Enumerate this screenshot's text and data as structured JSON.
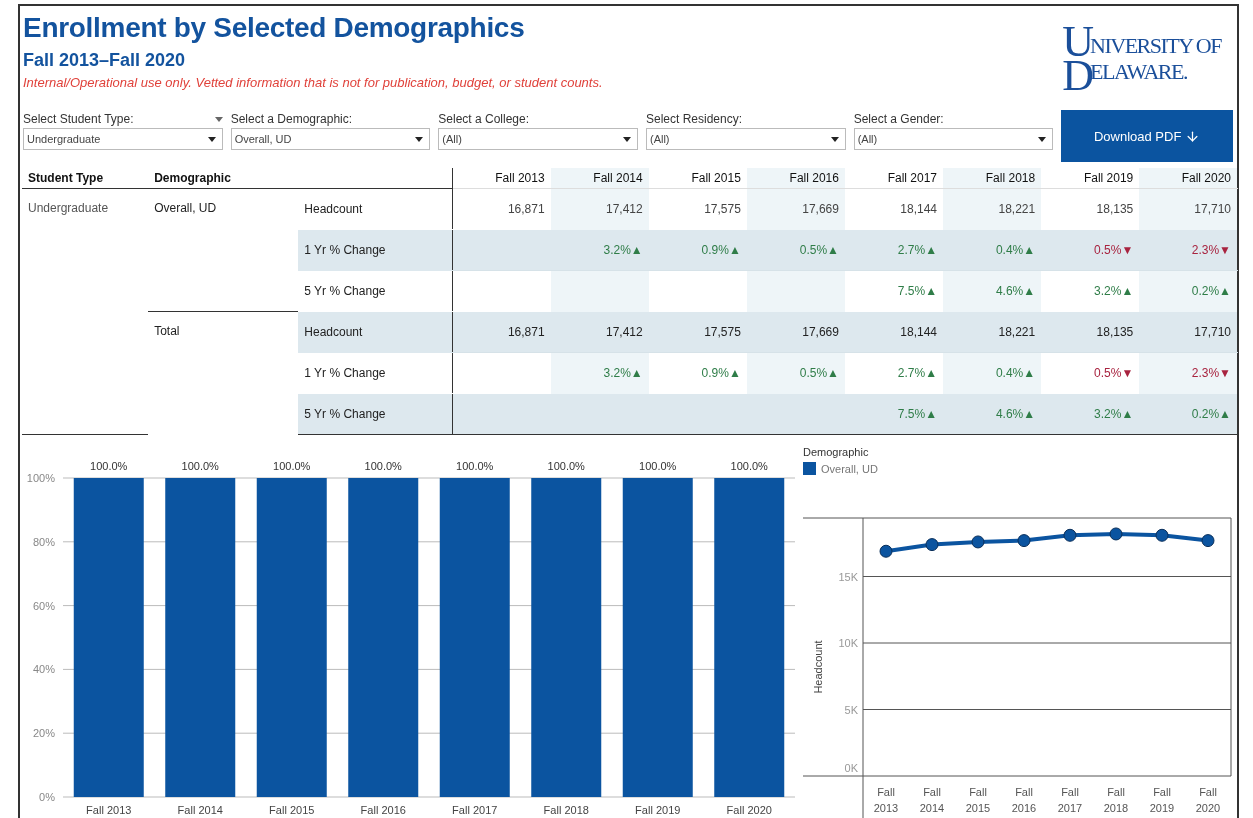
{
  "header": {
    "title": "Enrollment by Selected Demographics",
    "subtitle": "Fall 2013–Fall 2020",
    "note": "Internal/Operational use only. Vetted information that is not for publication, budget, or student counts."
  },
  "logo": {
    "initials": [
      "U",
      "D"
    ],
    "lines": [
      "NIVERSITY OF",
      "ELAWARE."
    ]
  },
  "filters": [
    {
      "label": "Select Student Type:",
      "value": "Undergraduate",
      "menu_icon": true
    },
    {
      "label": "Select a Demographic:",
      "value": "Overall, UD"
    },
    {
      "label": "Select a College:",
      "value": "(All)"
    },
    {
      "label": "Select Residency:",
      "value": "(All)"
    },
    {
      "label": "Select a Gender:",
      "value": "(All)"
    }
  ],
  "download_button": {
    "label": "Download PDF"
  },
  "table": {
    "columns": [
      "Student Type",
      "Demographic"
    ],
    "years": [
      "Fall 2013",
      "Fall 2014",
      "Fall 2015",
      "Fall 2016",
      "Fall 2017",
      "Fall 2018",
      "Fall 2019",
      "Fall 2020"
    ],
    "groups": [
      {
        "student_type": "Undergraduate",
        "demographics": [
          {
            "name": "Overall, UD",
            "measures": [
              {
                "label": "Headcount",
                "cells": [
                  {
                    "text": "16,871"
                  },
                  {
                    "text": "17,412"
                  },
                  {
                    "text": "17,575"
                  },
                  {
                    "text": "17,669"
                  },
                  {
                    "text": "18,144"
                  },
                  {
                    "text": "18,221"
                  },
                  {
                    "text": "18,135"
                  },
                  {
                    "text": "17,710"
                  }
                ]
              },
              {
                "label": "1 Yr % Change",
                "cells": [
                  null,
                  {
                    "text": "3.2%▲",
                    "color": "#2f7d48"
                  },
                  {
                    "text": "0.9%▲",
                    "color": "#2f7d48"
                  },
                  {
                    "text": "0.5%▲",
                    "color": "#2f7d48"
                  },
                  {
                    "text": "2.7%▲",
                    "color": "#2f7d48"
                  },
                  {
                    "text": "0.4%▲",
                    "color": "#2f7d48"
                  },
                  {
                    "text": "0.5%▼",
                    "color": "#a8233f"
                  },
                  {
                    "text": "2.3%▼",
                    "color": "#a8233f"
                  }
                ]
              },
              {
                "label": "5 Yr % Change",
                "cells": [
                  null,
                  null,
                  null,
                  null,
                  {
                    "text": "7.5%▲",
                    "color": "#2f7d48"
                  },
                  {
                    "text": "4.6%▲",
                    "color": "#2f7d48"
                  },
                  {
                    "text": "3.2%▲",
                    "color": "#2f7d48"
                  },
                  {
                    "text": "0.2%▲",
                    "color": "#2f7d48"
                  }
                ]
              }
            ]
          },
          {
            "name": "Total",
            "measures": [
              {
                "label": "Headcount",
                "cells": [
                  {
                    "text": "16,871"
                  },
                  {
                    "text": "17,412"
                  },
                  {
                    "text": "17,575"
                  },
                  {
                    "text": "17,669"
                  },
                  {
                    "text": "18,144"
                  },
                  {
                    "text": "18,221"
                  },
                  {
                    "text": "18,135"
                  },
                  {
                    "text": "17,710"
                  }
                ]
              },
              {
                "label": "1 Yr % Change",
                "cells": [
                  null,
                  {
                    "text": "3.2%▲",
                    "color": "#2f7d48"
                  },
                  {
                    "text": "0.9%▲",
                    "color": "#2f7d48"
                  },
                  {
                    "text": "0.5%▲",
                    "color": "#2f7d48"
                  },
                  {
                    "text": "2.7%▲",
                    "color": "#2f7d48"
                  },
                  {
                    "text": "0.4%▲",
                    "color": "#2f7d48"
                  },
                  {
                    "text": "0.5%▼",
                    "color": "#a8233f"
                  },
                  {
                    "text": "2.3%▼",
                    "color": "#a8233f"
                  }
                ]
              },
              {
                "label": "5 Yr % Change",
                "cells": [
                  null,
                  null,
                  null,
                  null,
                  {
                    "text": "7.5%▲",
                    "color": "#2f7d48"
                  },
                  {
                    "text": "4.6%▲",
                    "color": "#2f7d48"
                  },
                  {
                    "text": "3.2%▲",
                    "color": "#2f7d48"
                  },
                  {
                    "text": "0.2%▲",
                    "color": "#2f7d48"
                  }
                ]
              }
            ]
          }
        ]
      }
    ]
  },
  "bar_chart": {
    "chart_data": {
      "type": "bar",
      "categories": [
        "Fall 2013",
        "Fall 2014",
        "Fall 2015",
        "Fall 2016",
        "Fall 2017",
        "Fall 2018",
        "Fall 2019",
        "Fall 2020"
      ],
      "series": [
        {
          "color": "#0b54a0",
          "values": [
            100,
            100,
            100,
            100,
            100,
            100,
            100,
            100
          ]
        }
      ],
      "ylim": [
        0,
        100
      ],
      "grid": true,
      "yticks": [
        {
          "value": 0,
          "label": "0%"
        },
        {
          "value": 20,
          "label": "20%"
        },
        {
          "value": 40,
          "label": "40%"
        },
        {
          "value": 60,
          "label": "60%"
        },
        {
          "value": 80,
          "label": "80%"
        },
        {
          "value": 100,
          "label": "100%"
        }
      ],
      "value_labels": [
        "100.0%",
        "100.0%",
        "100.0%",
        "100.0%",
        "100.0%",
        "100.0%",
        "100.0%",
        "100.0%"
      ]
    }
  },
  "line_chart": {
    "legend": {
      "title": "Demographic"
    },
    "chart_data": {
      "type": "line",
      "ylabel": "Headcount",
      "categories": [
        "Fall 2013",
        "Fall 2014",
        "Fall 2015",
        "Fall 2016",
        "Fall 2017",
        "Fall 2018",
        "Fall 2019",
        "Fall 2020"
      ],
      "series": [
        {
          "name": "Overall, UD",
          "color": "#0b54a0",
          "marker": "circle",
          "values": [
            16900,
            17400,
            17600,
            17700,
            18100,
            18200,
            18100,
            17700
          ]
        }
      ],
      "ylim": [
        0,
        19400
      ],
      "grid": true,
      "yticks": [
        {
          "value": 0,
          "label": "0K"
        },
        {
          "value": 5000,
          "label": "5K"
        },
        {
          "value": 10000,
          "label": "10K"
        },
        {
          "value": 15000,
          "label": "15K"
        }
      ]
    }
  }
}
